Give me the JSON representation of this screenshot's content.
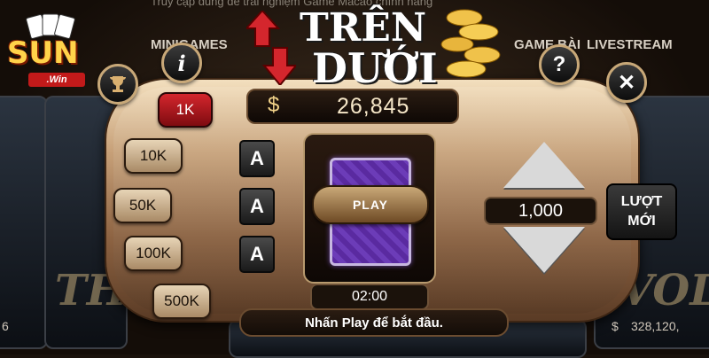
{
  "app": {
    "logo_text": "SUN",
    "logo_sub": ".Win"
  },
  "background": {
    "ticker": "Truy cập dùng để trải nghiệm Game Macao chính hãng",
    "nav_left": "MINIGAMES",
    "nav_mid": "GAME BÀI",
    "nav_right": "LIVESTREAM",
    "left_card_word": "THE",
    "right_card_word": "VOLTA",
    "left_value": "6",
    "right_value": "328,120,",
    "right_currency": "$"
  },
  "game": {
    "title_line1": "TRÊN",
    "title_line2": "DƯỚI",
    "balance_currency": "$",
    "balance": "26,845",
    "chips": [
      "1K",
      "10K",
      "50K",
      "100K",
      "500K"
    ],
    "selected_chip": "1K",
    "aces": [
      "A",
      "A",
      "A"
    ],
    "play_label": "PLAY",
    "timer": "02:00",
    "bet_value": "1,000",
    "reset_label_line1": "LƯỢT",
    "reset_label_line2": "MỚI",
    "status_message": "Nhấn Play để bắt đầu."
  },
  "buttons": {
    "info": "i",
    "help": "?",
    "close": "✕",
    "trophy": "🏆"
  },
  "colors": {
    "accent_red": "#d4262d",
    "gold": "#f2d38a",
    "panel": "#c7a078"
  }
}
